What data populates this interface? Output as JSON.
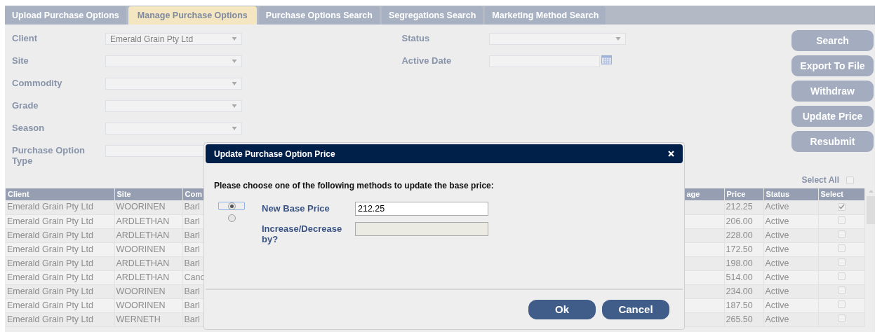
{
  "tabs": [
    {
      "label": "Upload Purchase Options",
      "selected": false
    },
    {
      "label": "Manage Purchase Options",
      "selected": true
    },
    {
      "label": "Purchase Options Search",
      "selected": false
    },
    {
      "label": "Segregations Search",
      "selected": false
    },
    {
      "label": "Marketing Method Search",
      "selected": false
    }
  ],
  "filters_left": [
    {
      "label": "Client",
      "kind": "select",
      "value": "Emerald Grain Pty Ltd"
    },
    {
      "label": "Site",
      "kind": "select"
    },
    {
      "label": "Commodity",
      "kind": "select"
    },
    {
      "label": "Grade",
      "kind": "select"
    },
    {
      "label": "Season",
      "kind": "select"
    },
    {
      "label": "Purchase Option Type",
      "kind": "text"
    }
  ],
  "filters_right": [
    {
      "label": "Status",
      "kind": "select"
    },
    {
      "label": "Active Date",
      "kind": "date"
    }
  ],
  "action_buttons": [
    "Search",
    "Export To File",
    "Withdraw",
    "Update Price",
    "Resubmit"
  ],
  "select_all": {
    "label": "Select All",
    "checked": false
  },
  "table": {
    "columns": [
      "Client",
      "Site",
      "Com",
      "",
      "age",
      "Price",
      "Status",
      "Select"
    ],
    "rows": [
      {
        "cells": [
          "Emerald Grain Pty Ltd",
          "WOORINEN",
          "Barl",
          "",
          "",
          "212.25",
          "Active"
        ],
        "selected": true
      },
      {
        "cells": [
          "Emerald Grain Pty Ltd",
          "ARDLETHAN",
          "Barl",
          "",
          "",
          "206.00",
          "Active"
        ],
        "selected": false
      },
      {
        "cells": [
          "Emerald Grain Pty Ltd",
          "ARDLETHAN",
          "Barl",
          "",
          "",
          "228.00",
          "Active"
        ],
        "selected": false
      },
      {
        "cells": [
          "Emerald Grain Pty Ltd",
          "WOORINEN",
          "Barl",
          "",
          "",
          "172.50",
          "Active"
        ],
        "selected": false
      },
      {
        "cells": [
          "Emerald Grain Pty Ltd",
          "ARDLETHAN",
          "Barl",
          "",
          "",
          "198.00",
          "Active"
        ],
        "selected": false
      },
      {
        "cells": [
          "Emerald Grain Pty Ltd",
          "ARDLETHAN",
          "Canc",
          "",
          "",
          "514.00",
          "Active"
        ],
        "selected": false
      },
      {
        "cells": [
          "Emerald Grain Pty Ltd",
          "WOORINEN",
          "Barl",
          "",
          "",
          "234.00",
          "Active"
        ],
        "selected": false
      },
      {
        "cells": [
          "Emerald Grain Pty Ltd",
          "WOORINEN",
          "Barl",
          "",
          "",
          "187.50",
          "Active"
        ],
        "selected": false
      },
      {
        "cells": [
          "Emerald Grain Pty Ltd",
          "WERNETH",
          "Barl",
          "",
          "",
          "265.50",
          "Active"
        ],
        "selected": false
      }
    ]
  },
  "dialog": {
    "title": "Update Purchase Option Price",
    "prompt": "Please choose one of the following methods to update the base price:",
    "options": [
      {
        "label": "New Base Price",
        "selected": true,
        "value": "212.25"
      },
      {
        "label": "Increase/Decrease by?",
        "selected": false
      }
    ],
    "buttons": [
      "Ok",
      "Cancel"
    ]
  }
}
